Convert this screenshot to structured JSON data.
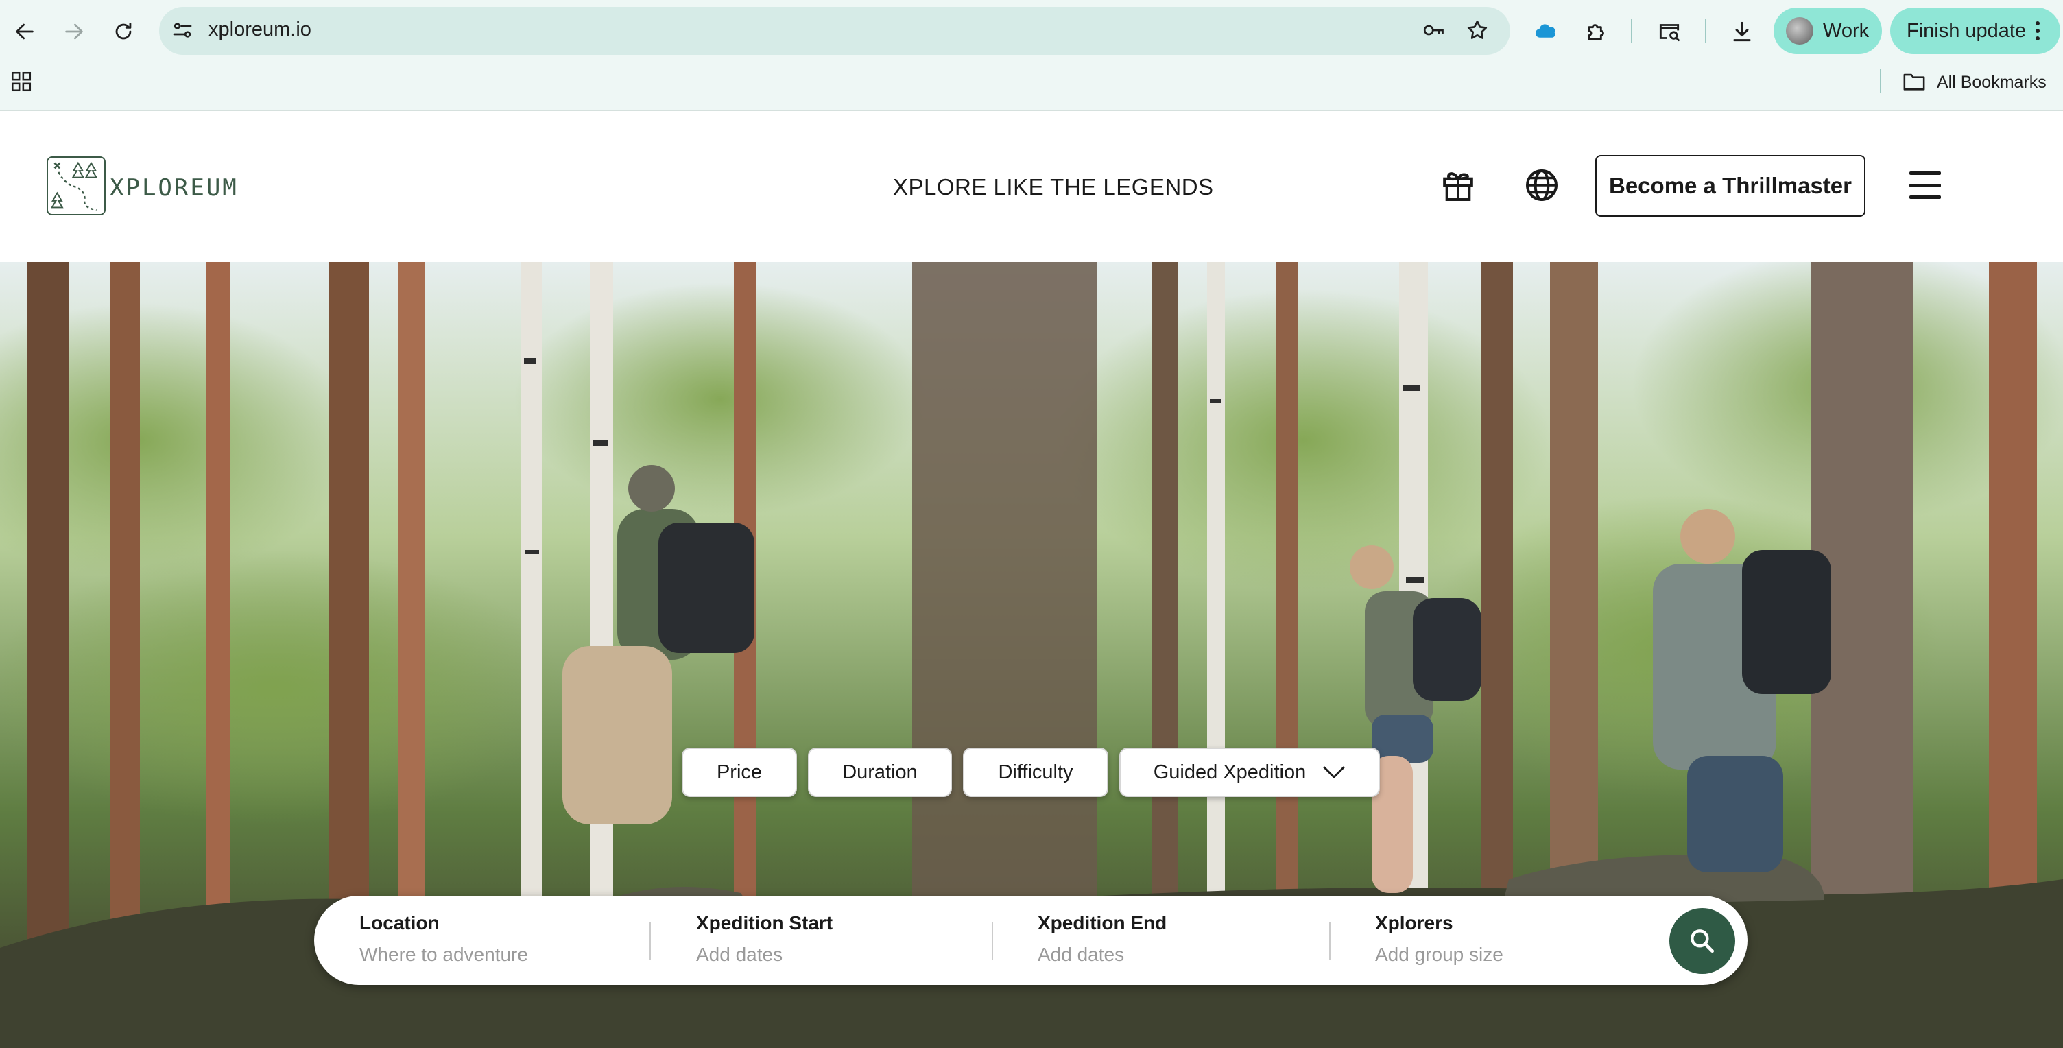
{
  "browser": {
    "url": "xploreum.io",
    "profile_label": "Work",
    "update_label": "Finish update",
    "bookmarks_label": "All Bookmarks"
  },
  "header": {
    "logo_text": "XPLOREUM",
    "tagline": "XPLORE LIKE THE LEGENDS",
    "cta_label": "Become a Thrillmaster"
  },
  "filters": {
    "price": "Price",
    "duration": "Duration",
    "difficulty": "Difficulty",
    "guided": "Guided Xpedition"
  },
  "search": {
    "location_label": "Location",
    "location_placeholder": "Where to adventure",
    "start_label": "Xpedition Start",
    "start_placeholder": "Add dates",
    "end_label": "Xpedition End",
    "end_placeholder": "Add dates",
    "explorers_label": "Xplorers",
    "explorers_placeholder": "Add group size"
  },
  "colors": {
    "brand_green": "#2f5a45",
    "chrome_bg": "#eef7f5",
    "chip_teal": "#8fe6d6"
  },
  "icons": {
    "back": "back-arrow-icon",
    "forward": "forward-arrow-icon",
    "reload": "reload-icon",
    "site_info": "site-info-icon",
    "key": "password-key-icon",
    "star": "bookmark-star-icon",
    "extensions": "puzzle-icon",
    "download": "download-icon",
    "gift": "gift-icon",
    "globe": "globe-icon",
    "menu": "hamburger-menu-icon",
    "search": "search-icon"
  }
}
